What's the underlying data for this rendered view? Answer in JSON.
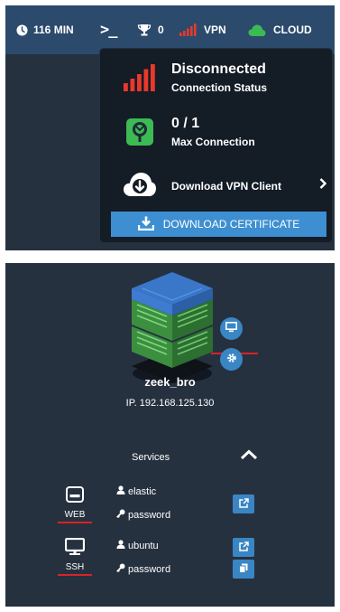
{
  "topbar": {
    "time_label": "116 MIN",
    "terminal_glyph": ">_",
    "trophy_count": "0",
    "vpn_label": "VPN",
    "cloud_label": "CLOUD",
    "icons": [
      "clock-icon",
      "terminal-icon",
      "trophy-icon",
      "signal-icon",
      "cloud-icon"
    ]
  },
  "vpn_dropdown": {
    "status_title": "Disconnected",
    "status_subtitle": "Connection Status",
    "connection_count": "0 / 1",
    "connection_subtitle": "Max Connection",
    "download_client_label": "Download VPN Client",
    "download_certificate_label": "DOWNLOAD CERTIFICATE"
  },
  "machine": {
    "name": "zeek_bro",
    "ip": "IP. 192.168.125.130",
    "services_label": "Services",
    "services": [
      {
        "label": "WEB",
        "icon": "web-server-icon",
        "username": "elastic",
        "password": "password",
        "actions": [
          "open-external-icon"
        ]
      },
      {
        "label": "SSH",
        "icon": "monitor-icon",
        "username": "ubuntu",
        "password": "password",
        "actions": [
          "open-external-icon",
          "copy-icon"
        ]
      }
    ]
  },
  "colors": {
    "topbar_bg": "#2b4a6c",
    "panel_bg": "#26313f",
    "dropdown_bg": "#141c26",
    "accent_blue": "#3d8fd1",
    "signal_red": "#e8392b",
    "cloud_green": "#3cba54",
    "underline_red": "#d8232a"
  }
}
